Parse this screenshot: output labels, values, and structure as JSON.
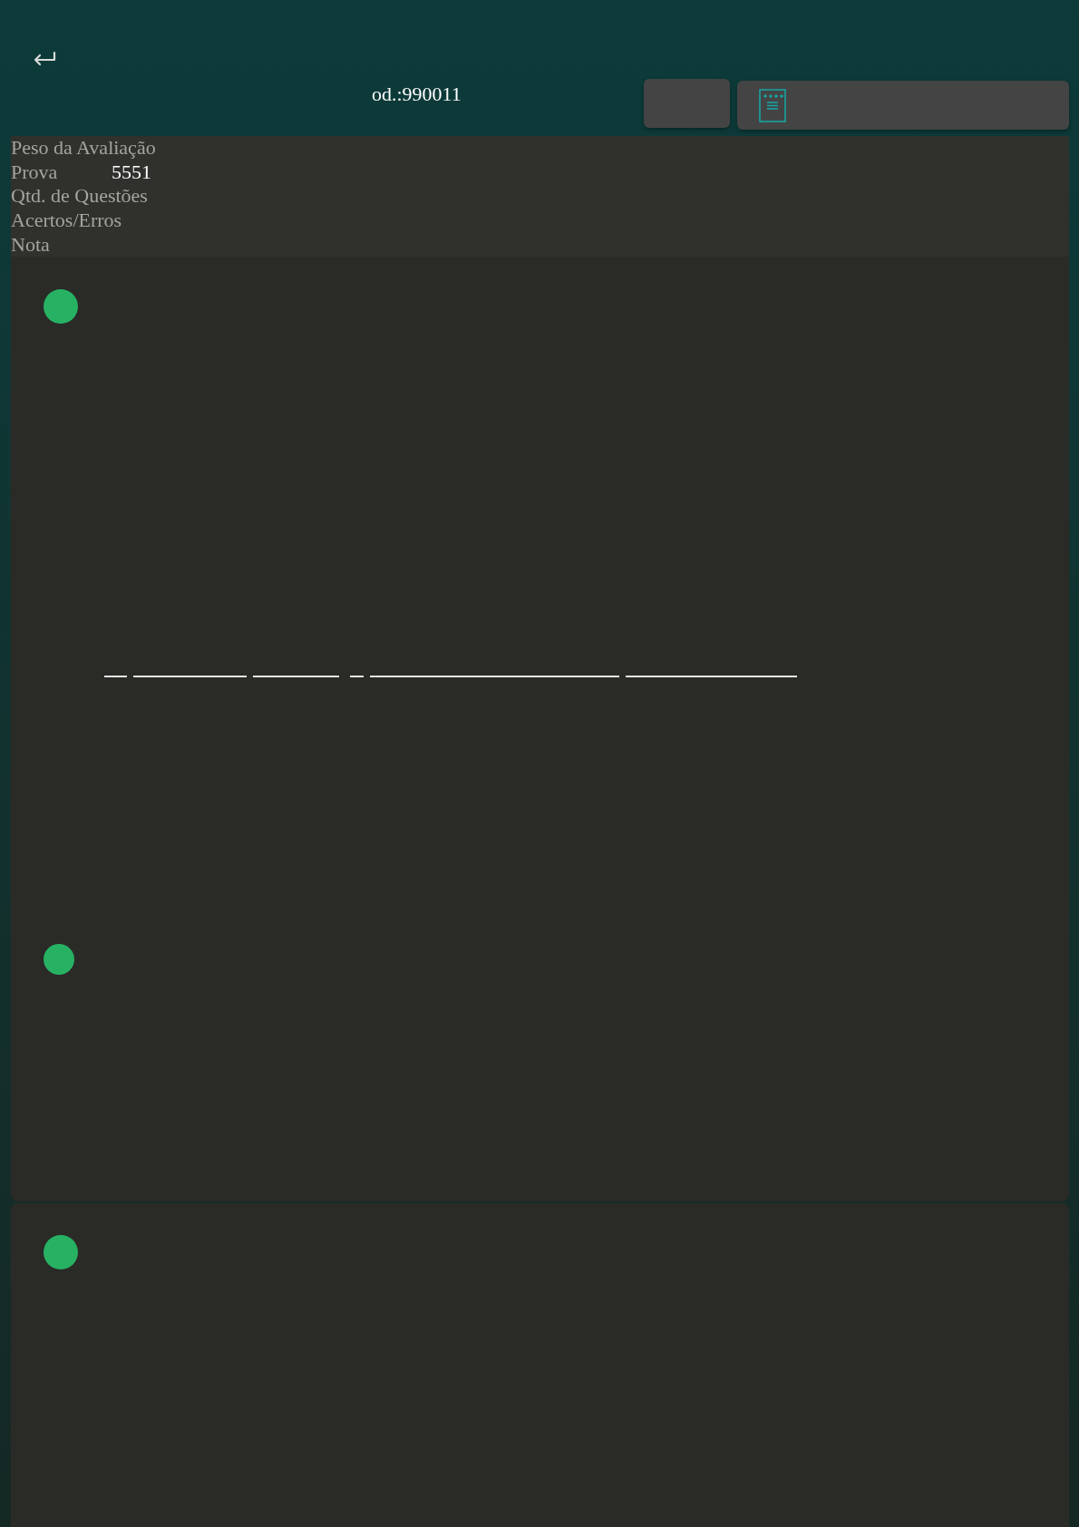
{
  "header": {
    "title": "od.:990011"
  },
  "summary": [
    {
      "label": "Peso da Avaliação"
    },
    {
      "label": "Prova",
      "value": "5551"
    },
    {
      "label": "Qtd. de Questões"
    },
    {
      "label": "Acertos/Erros"
    },
    {
      "label": "Nota"
    }
  ]
}
